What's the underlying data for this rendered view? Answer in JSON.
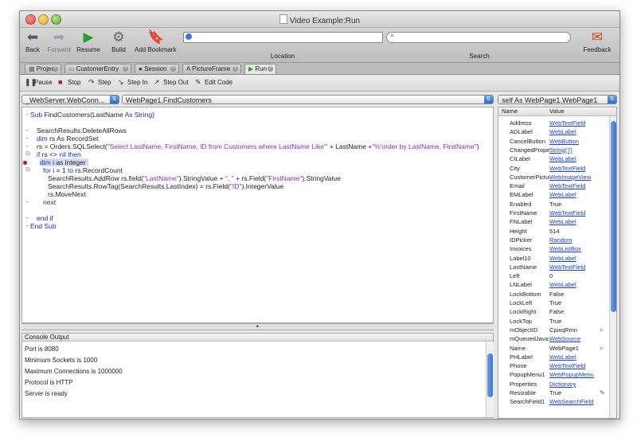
{
  "window": {
    "title": "Video Example:Run"
  },
  "toolbar": {
    "back": "Back",
    "forward": "Forward",
    "resume": "Resume",
    "build": "Build",
    "add_bookmark": "Add Bookmark",
    "location": "Location",
    "search": "Search",
    "feedback": "Feedback"
  },
  "tabs": [
    {
      "label": "Project"
    },
    {
      "label": "CustomerEntry"
    },
    {
      "label": "Session"
    },
    {
      "label": "PictureFrame"
    },
    {
      "label": "Run"
    }
  ],
  "debug": {
    "pause": "Pause",
    "stop": "Stop",
    "step": "Step",
    "step_in": "Step In",
    "step_out": "Step Out",
    "edit_code": "Edit Code"
  },
  "popups": {
    "stack": "_WebServer.WebConn...",
    "method": "WebPage1.FindCustomers",
    "self": "self As WebPage1.WebPage1"
  },
  "code": {
    "l1": "FindCustomers(LastName",
    "l3": "SearchResults.DeleteAllRows",
    "l4": " rs As RecordSet",
    "l5a": "rs = Orders.SQLSelect(",
    "l5s1": "\"Select LastName, FirstName, ID from Customers where LastName Like'\"",
    "l5b": " + LastName +",
    "l5s2": "\"%'order by LastName, FirstName\"",
    "l5c": ")",
    "l6a": " rs <> ",
    "l7": " i as integer",
    "l8a": " i = 1 ",
    "l8b": " rs.RecordCount",
    "l9a": "SearchResults.AddRow rs.field(",
    "l9s1": "\"LastName\"",
    "l9b": ").StringValue + ",
    "l9s2": "\", \"",
    "l9c": " + rs.Field(",
    "l9s3": "\"FirstName\"",
    "l9d": ").StringValue",
    "l10a": "SearchResults.RowTag(SearchResults.LastIndex) = rs.Field(",
    "l10s": "\"ID\"",
    "l10b": ").IntegerValue",
    "l11": "rs.MoveNext",
    "l14": "End Sub",
    "kw_sub": "Sub",
    "kw_as": "As",
    "kw_string": "String",
    "kw_dim": "dim",
    "kw_if": "if",
    "kw_nil": "nil",
    "kw_then": "then",
    "kw_dim2": "dim",
    "kw_for": "for",
    "kw_to": "to",
    "kw_next": "next",
    "kw_endif": "end if"
  },
  "console": {
    "title": "Console Output",
    "lines": [
      "Port is 8080",
      "Minimum Sockets is 1000",
      "Maximum Connections is 1000000",
      "Protocol is HTTP",
      "Server is ready"
    ]
  },
  "props": {
    "col_name": "Name",
    "col_value": "Value",
    "rows": [
      {
        "name": "Address",
        "value": "WebTextField",
        "link": true
      },
      {
        "name": "ADLabel",
        "value": "WebLabel",
        "link": true
      },
      {
        "name": "CancelButton",
        "value": "WebButton",
        "link": true
      },
      {
        "name": "ChangedPrope...",
        "value": "String(7)",
        "link": true
      },
      {
        "name": "CILabel",
        "value": "WebLabel",
        "link": true
      },
      {
        "name": "City",
        "value": "WebTextField",
        "link": true
      },
      {
        "name": "CustomerPicture",
        "value": "WebImageView",
        "link": true
      },
      {
        "name": "Email",
        "value": "WebTextField",
        "link": true
      },
      {
        "name": "EMLabel",
        "value": "WebLabel",
        "link": true
      },
      {
        "name": "Enabled",
        "value": "True",
        "link": false
      },
      {
        "name": "FirstName",
        "value": "WebTextField",
        "link": true
      },
      {
        "name": "FNLabel",
        "value": "WebLabel",
        "link": true
      },
      {
        "name": "Height",
        "value": "514",
        "link": false
      },
      {
        "name": "IDPicker",
        "value": "Random",
        "link": true
      },
      {
        "name": "Invoices",
        "value": "WebListBox",
        "link": true
      },
      {
        "name": "Label10",
        "value": "WebLabel",
        "link": true
      },
      {
        "name": "LastName",
        "value": "WebTextField",
        "link": true
      },
      {
        "name": "Left",
        "value": "0",
        "link": false
      },
      {
        "name": "LNLabel",
        "value": "WebLabel",
        "link": true
      },
      {
        "name": "LockBottom",
        "value": "False",
        "link": false
      },
      {
        "name": "LockLeft",
        "value": "True",
        "link": false
      },
      {
        "name": "LockRight",
        "value": "False",
        "link": false
      },
      {
        "name": "LockTop",
        "value": "True",
        "link": false
      },
      {
        "name": "mObjectID",
        "value": "CpixqRmn",
        "link": false
      },
      {
        "name": "mQueuedJava...",
        "value": "WebSource",
        "link": true
      },
      {
        "name": "Name",
        "value": "WebPage1",
        "link": false
      },
      {
        "name": "PHLabel",
        "value": "WebLabel",
        "link": true
      },
      {
        "name": "Phone",
        "value": "WebTextField",
        "link": true
      },
      {
        "name": "PopupMenu1",
        "value": "WebPopupMenu",
        "link": true
      },
      {
        "name": "Properties",
        "value": "Dictionary",
        "link": true
      },
      {
        "name": "Resizable",
        "value": "True",
        "link": false
      },
      {
        "name": "SearchField1",
        "value": "WebSearchField",
        "link": true
      }
    ]
  }
}
